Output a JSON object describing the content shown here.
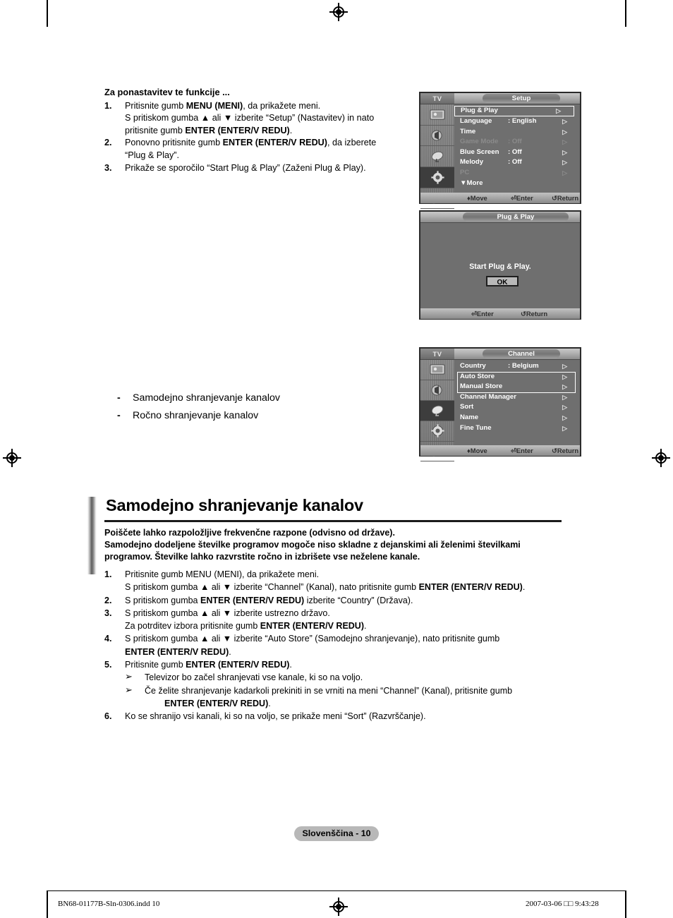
{
  "top_section": {
    "title": "Za ponastavitev te funkcije ...",
    "steps": [
      {
        "num": "1.",
        "lines": [
          [
            {
              "t": "Pritisnite gumb ",
              "b": false
            },
            {
              "t": "MENU (MENI)",
              "b": true
            },
            {
              "t": ", da prikažete meni.",
              "b": false
            }
          ],
          [
            {
              "t": "S pritiskom gumba ▲ ali ▼ izberite “Setup” (Nastavitev) in nato",
              "b": false
            }
          ],
          [
            {
              "t": "pritisnite gumb ",
              "b": false
            },
            {
              "t": "ENTER (ENTER/V REDU)",
              "b": true
            },
            {
              "t": ".",
              "b": false
            }
          ]
        ]
      },
      {
        "num": "2.",
        "lines": [
          [
            {
              "t": "Ponovno pritisnite gumb ",
              "b": false
            },
            {
              "t": "ENTER (ENTER/V REDU)",
              "b": true
            },
            {
              "t": ", da izberete",
              "b": false
            }
          ],
          [
            {
              "t": "“Plug & Play”.",
              "b": false
            }
          ]
        ]
      },
      {
        "num": "3.",
        "lines": [
          [
            {
              "t": "Prikaže se sporočilo “Start Plug & Play” (Zaženi Plug & Play).",
              "b": false
            }
          ]
        ]
      }
    ]
  },
  "mid_list": {
    "dash": "-",
    "items": [
      "Samodejno shranjevanje kanalov",
      "Ročno shranjevanje kanalov"
    ]
  },
  "section": {
    "heading": "Samodejno shranjevanje kanalov",
    "intro_lines": [
      "Poiščete lahko razpoložljive frekvenčne razpone (odvisno od države).",
      "Samodejno dodeljene številke programov mogoče niso skladne z dejanskimi ali želenimi številkami",
      "programov. Številke lahko razvrstite ročno in izbrišete vse neželene kanale."
    ],
    "steps": [
      {
        "num": "1.",
        "lines": [
          [
            {
              "t": "Pritisnite gumb MENU (MENI), da prikažete meni.",
              "b": false
            }
          ],
          [
            {
              "t": "S pritiskom gumba ▲ ali ▼ izberite “Channel” (Kanal), nato pritisnite gumb ",
              "b": false
            },
            {
              "t": "ENTER (ENTER/V REDU)",
              "b": true
            },
            {
              "t": ".",
              "b": false
            }
          ]
        ]
      },
      {
        "num": "2.",
        "lines": [
          [
            {
              "t": "S pritiskom gumba ",
              "b": false
            },
            {
              "t": "ENTER (ENTER/V REDU)",
              "b": true
            },
            {
              "t": " izberite “Country” (Država).",
              "b": false
            }
          ]
        ]
      },
      {
        "num": "3.",
        "lines": [
          [
            {
              "t": "S pritiskom gumba ▲ ali ▼ izberite ustrezno državo.",
              "b": false
            }
          ],
          [
            {
              "t": "Za potrditev izbora pritisnite gumb ",
              "b": false
            },
            {
              "t": "ENTER (ENTER/V REDU)",
              "b": true
            },
            {
              "t": ".",
              "b": false
            }
          ]
        ]
      },
      {
        "num": "4.",
        "lines": [
          [
            {
              "t": "S pritiskom gumba ▲ ali ▼ izberite “Auto Store” (Samodejno shranjevanje), nato pritisnite gumb",
              "b": false
            }
          ],
          [
            {
              "t": "ENTER (ENTER/V REDU)",
              "b": true
            },
            {
              "t": ".",
              "b": false
            }
          ]
        ]
      },
      {
        "num": "5.",
        "lines": [
          [
            {
              "t": "Pritisnite gumb ",
              "b": false
            },
            {
              "t": "ENTER (ENTER/V REDU)",
              "b": true
            },
            {
              "t": ".",
              "b": false
            }
          ]
        ],
        "notes": [
          {
            "marker": "➢",
            "lines": [
              [
                {
                  "t": "Televizor bo začel shranjevati vse kanale, ki so na voljo.",
                  "b": false
                }
              ]
            ]
          },
          {
            "marker": "➢",
            "lines": [
              [
                {
                  "t": "Če želite shranjevanje kadarkoli prekiniti in se vrniti na meni “Channel” (Kanal), pritisnite gumb",
                  "b": false
                }
              ],
              [
                {
                  "t": "ENTER (ENTER/V REDU)",
                  "b": true
                },
                {
                  "t": ".",
                  "b": false
                }
              ]
            ],
            "indent_last": true
          }
        ]
      },
      {
        "num": "6.",
        "lines": [
          [
            {
              "t": "Ko se shranijo vsi kanali, ki so na voljo, se prikaže meni “Sort” (Razvrščanje).",
              "b": false
            }
          ]
        ]
      }
    ]
  },
  "osd_setup": {
    "source_label": "TV",
    "title": "Setup",
    "rows": [
      {
        "label": "Plug & Play",
        "value": "",
        "arrow": "▷",
        "selected": true,
        "dim": false
      },
      {
        "label": "Language",
        "value": ": English",
        "arrow": "▷",
        "selected": false,
        "dim": false
      },
      {
        "label": "Time",
        "value": "",
        "arrow": "▷",
        "selected": false,
        "dim": false
      },
      {
        "label": "Game Mode",
        "value": ": Off",
        "arrow": "▷",
        "selected": false,
        "dim": true
      },
      {
        "label": "Blue Screen",
        "value": ": Off",
        "arrow": "▷",
        "selected": false,
        "dim": false
      },
      {
        "label": "Melody",
        "value": ": Off",
        "arrow": "▷",
        "selected": false,
        "dim": false
      },
      {
        "label": "PC",
        "value": "",
        "arrow": "▷",
        "selected": false,
        "dim": true
      }
    ],
    "more": "▼More",
    "status": {
      "move": "Move",
      "enter": "Enter",
      "return": "Return"
    }
  },
  "osd_pnp": {
    "title": "Plug & Play",
    "message": "Start Plug & Play.",
    "ok_label": "OK",
    "status": {
      "enter": "Enter",
      "return": "Return"
    }
  },
  "osd_channel": {
    "source_label": "TV",
    "title": "Channel",
    "rows": [
      {
        "label": "Country",
        "value": ": Belgium",
        "arrow": "▷"
      },
      {
        "label": "Auto Store",
        "value": "",
        "arrow": "▷"
      },
      {
        "label": "Manual Store",
        "value": "",
        "arrow": "▷"
      },
      {
        "label": "Channel Manager",
        "value": "",
        "arrow": "▷"
      },
      {
        "label": "Sort",
        "value": "",
        "arrow": "▷"
      },
      {
        "label": "Name",
        "value": "",
        "arrow": "▷"
      },
      {
        "label": "Fine Tune",
        "value": "",
        "arrow": "▷"
      }
    ],
    "status": {
      "move": "Move",
      "enter": "Enter",
      "return": "Return"
    }
  },
  "footer": {
    "page_badge": "Slovenščina - 10",
    "file": "BN68-01177B-Sln-0306.indd   10",
    "timestamp": "2007-03-06   □□ 9:43:28"
  }
}
